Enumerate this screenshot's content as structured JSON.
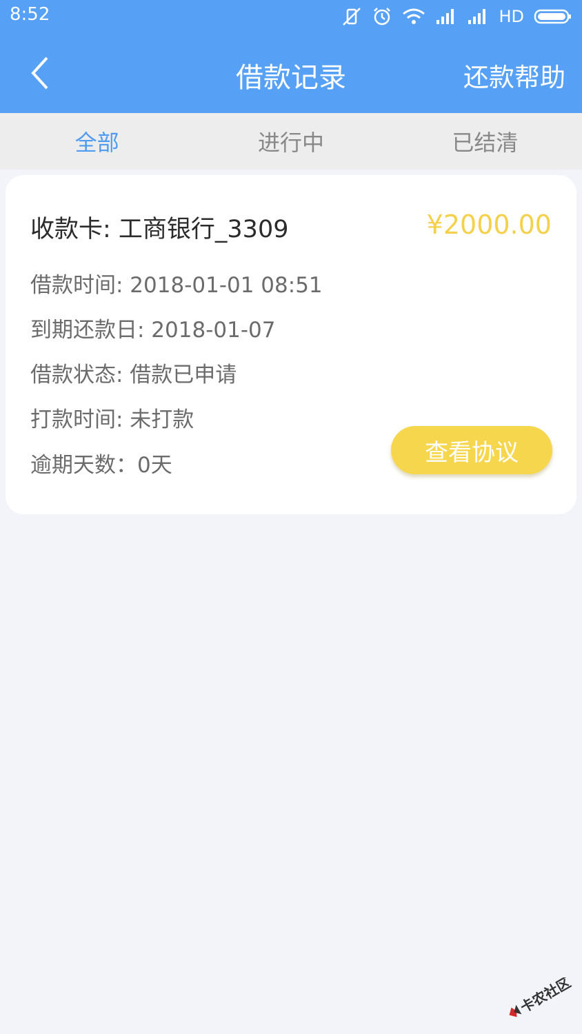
{
  "status_bar": {
    "time": "8:52",
    "hd": "HD",
    "icons": [
      "vibrate-off-icon",
      "alarm-icon",
      "wifi-icon",
      "signal-icon",
      "signal-icon",
      "battery-icon"
    ]
  },
  "nav": {
    "title": "借款记录",
    "help_label": "还款帮助",
    "back_icon": "chevron-left-icon"
  },
  "tabs": [
    {
      "label": "全部",
      "active": true
    },
    {
      "label": "进行中",
      "active": false
    },
    {
      "label": "已结清",
      "active": false
    }
  ],
  "record": {
    "card_label": "收款卡: 工商银行_3309",
    "amount": "¥2000.00",
    "rows": [
      "借款时间: 2018-01-01 08:51",
      "到期还款日: 2018-01-07",
      "借款状态: 借款已申请",
      "打款时间: 未打款",
      "逾期天数：0天"
    ],
    "agreement_button": "查看协议"
  },
  "watermark": {
    "text": "卡农社区"
  },
  "colors": {
    "header_blue": "#56a1f5",
    "active_tab": "#4f9bf0",
    "amount_yellow": "#f4d04b",
    "button_yellow": "#f5d64d"
  }
}
